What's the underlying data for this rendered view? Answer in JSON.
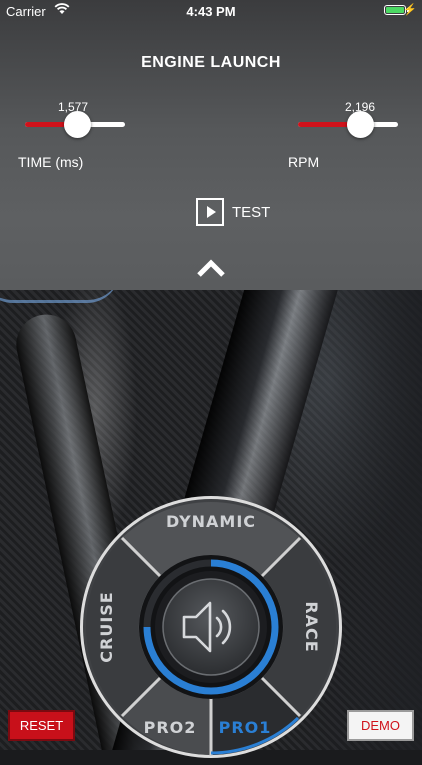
{
  "status_bar": {
    "carrier": "Carrier",
    "time": "4:43 PM",
    "battery_color": "#4cd964"
  },
  "header": {
    "title": "ENGINE LAUNCH"
  },
  "sliders": {
    "time": {
      "label": "TIME (ms)",
      "value": "1,577",
      "fraction": 0.52
    },
    "rpm": {
      "label": "RPM",
      "value": "2,196",
      "fraction": 0.62
    }
  },
  "test_button": {
    "label": "TEST",
    "icon": "play-icon"
  },
  "expand": {
    "icon": "chevron-up-icon"
  },
  "mode_dial": {
    "modes": {
      "top": "DYNAMIC",
      "left": "CRUISE",
      "right": "RACE",
      "bottom_left": "PRO2",
      "bottom_right": "PRO1"
    },
    "selected": "PRO1",
    "center_icon": "speaker-icon",
    "accent_color": "#2a7fd4"
  },
  "footer": {
    "reset_label": "RESET",
    "demo_label": "DEMO",
    "reset_color": "#c8101a",
    "demo_text_color": "#d0121b"
  }
}
